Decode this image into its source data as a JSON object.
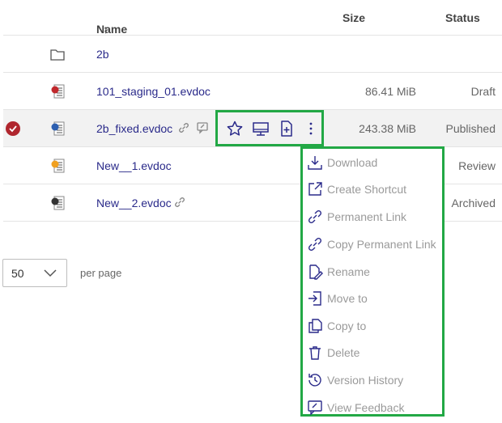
{
  "header": {
    "name": "Name",
    "sort_arrow": "↑",
    "size": "Size",
    "status": "Status"
  },
  "rows": [
    {
      "name": "2b",
      "size": "",
      "status": "",
      "icon": "folder-icon"
    },
    {
      "name": "101_staging_01.evdoc",
      "size": "86.41 MiB",
      "status": "Draft",
      "icon": "evdoc-red-icon"
    },
    {
      "name": "2b_fixed.evdoc",
      "size": "243.38 MiB",
      "status": "Published",
      "icon": "evdoc-blue-icon"
    },
    {
      "name": "New__1.evdoc",
      "size": "",
      "status": "Review",
      "icon": "evdoc-orange-icon"
    },
    {
      "name": "New__2.evdoc",
      "size": "",
      "status": "Archived",
      "icon": "evdoc-dark-icon"
    }
  ],
  "context_menu": {
    "items": [
      {
        "label": "Download",
        "icon": "download-icon"
      },
      {
        "label": "Create Shortcut",
        "icon": "shortcut-icon"
      },
      {
        "label": "Permanent Link",
        "icon": "link-icon"
      },
      {
        "label": "Copy Permanent Link",
        "icon": "link-icon"
      },
      {
        "label": "Rename",
        "icon": "rename-icon"
      },
      {
        "label": "Move to",
        "icon": "move-icon"
      },
      {
        "label": "Copy to",
        "icon": "copy-icon"
      },
      {
        "label": "Delete",
        "icon": "trash-icon"
      },
      {
        "label": "Version History",
        "icon": "history-icon"
      },
      {
        "label": "View Feedback",
        "icon": "feedback-icon"
      }
    ]
  },
  "pagination": {
    "per_page_value": "50",
    "per_page_label": "per page"
  },
  "colors": {
    "accent": "#2a2a8a",
    "highlight": "#22a845",
    "check": "#b0262e"
  }
}
